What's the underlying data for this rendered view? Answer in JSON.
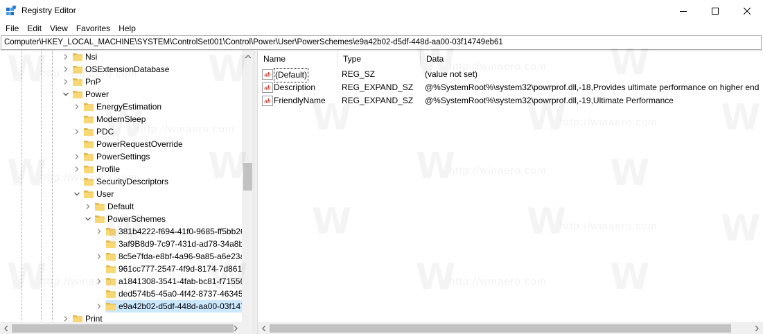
{
  "window": {
    "title": "Registry Editor",
    "app_icon": "regedit-icon",
    "controls": [
      "minimize-icon",
      "maximize-icon",
      "close-icon"
    ]
  },
  "menu": [
    "File",
    "Edit",
    "View",
    "Favorites",
    "Help"
  ],
  "address": "Computer\\HKEY_LOCAL_MACHINE\\SYSTEM\\ControlSet001\\Control\\Power\\User\\PowerSchemes\\e9a42b02-d5df-448d-aa00-03f14749eb61",
  "tree": [
    {
      "label": "Nsi",
      "level": 0,
      "expander": "collapsed"
    },
    {
      "label": "OSExtensionDatabase",
      "level": 0,
      "expander": "collapsed"
    },
    {
      "label": "PnP",
      "level": 0,
      "expander": "collapsed"
    },
    {
      "label": "Power",
      "level": 0,
      "expander": "expanded"
    },
    {
      "label": "EnergyEstimation",
      "level": 1,
      "expander": "collapsed"
    },
    {
      "label": "ModernSleep",
      "level": 1,
      "expander": "none"
    },
    {
      "label": "PDC",
      "level": 1,
      "expander": "collapsed"
    },
    {
      "label": "PowerRequestOverride",
      "level": 1,
      "expander": "none"
    },
    {
      "label": "PowerSettings",
      "level": 1,
      "expander": "collapsed"
    },
    {
      "label": "Profile",
      "level": 1,
      "expander": "collapsed"
    },
    {
      "label": "SecurityDescriptors",
      "level": 1,
      "expander": "none"
    },
    {
      "label": "User",
      "level": 1,
      "expander": "expanded"
    },
    {
      "label": "Default",
      "level": 2,
      "expander": "collapsed"
    },
    {
      "label": "PowerSchemes",
      "level": 2,
      "expander": "expanded"
    },
    {
      "label": "381b4222-f694-41f0-9685-ff5bb26",
      "level": 3,
      "expander": "collapsed"
    },
    {
      "label": "3af9B8d9-7c97-431d-ad78-34a8bf",
      "level": 3,
      "expander": "none"
    },
    {
      "label": "8c5e7fda-e8bf-4a96-9a85-a6e23a8",
      "level": 3,
      "expander": "collapsed"
    },
    {
      "label": "961cc777-2547-4f9d-8174-7d86181",
      "level": 3,
      "expander": "none"
    },
    {
      "label": "a1841308-3541-4fab-bc81-f71556f",
      "level": 3,
      "expander": "collapsed"
    },
    {
      "label": "ded574b5-45a0-4f42-8737-46345c",
      "level": 3,
      "expander": "none"
    },
    {
      "label": "e9a42b02-d5df-448d-aa00-03f1474",
      "level": 3,
      "expander": "collapsed",
      "selected": true
    },
    {
      "label": "Print",
      "level": 0,
      "expander": "collapsed"
    }
  ],
  "columns": [
    "Name",
    "Type",
    "Data"
  ],
  "values": [
    {
      "name": "(Default)",
      "type": "REG_SZ",
      "data": "(value not set)",
      "icon": "string-value-icon"
    },
    {
      "name": "Description",
      "type": "REG_EXPAND_SZ",
      "data": "@%SystemRoot%\\system32\\powrprof.dll,-18,Provides ultimate performance on higher end",
      "icon": "string-value-icon"
    },
    {
      "name": "FriendlyName",
      "type": "REG_EXPAND_SZ",
      "data": "@%SystemRoot%\\system32\\powrprof.dll,-19,Ultimate Performance",
      "icon": "string-value-icon"
    }
  ],
  "colors": {
    "selection": "#cce8ff",
    "folder": "#f8d775",
    "folder_dark": "#e2b648",
    "scrollbar_thumb": "#c2c2c2",
    "scrollbar_track": "#f0f0f0"
  },
  "watermark": "http://winaero.com"
}
